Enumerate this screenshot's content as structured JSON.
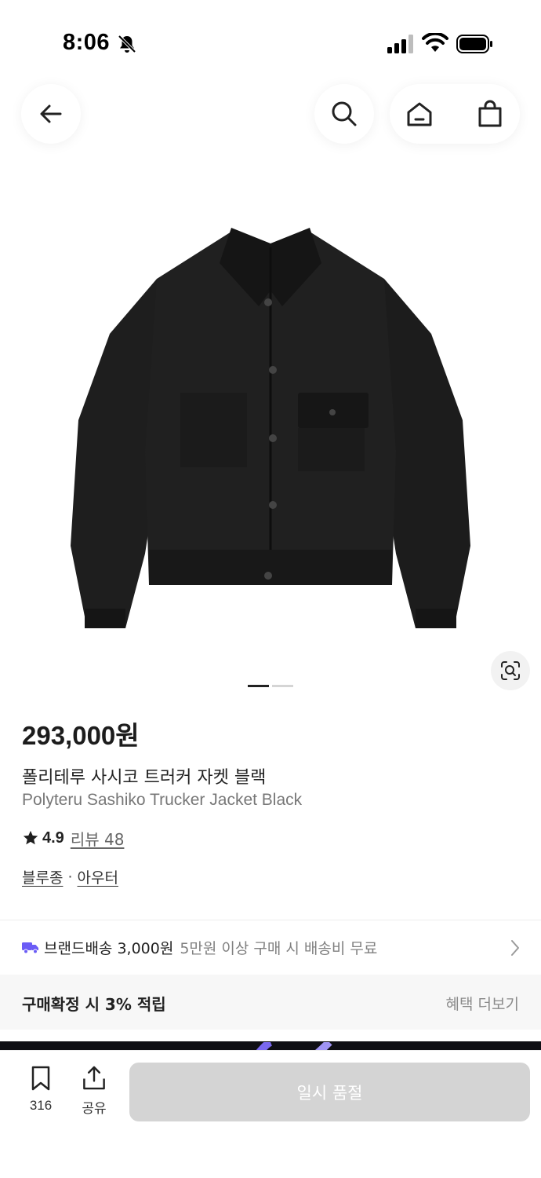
{
  "status_bar": {
    "time": "8:06",
    "icons": [
      "bell-slash-icon",
      "signal-icon",
      "wifi-icon",
      "battery-icon"
    ]
  },
  "header": {
    "icons": [
      "back-arrow-icon",
      "search-icon",
      "home-icon",
      "shopping-bag-icon"
    ]
  },
  "product": {
    "image_alt_icon": "black-jacket-image",
    "carousel": {
      "total": 2,
      "current": 1
    },
    "price": "293,000원",
    "name_ko": "폴리테루 사시코 트러커 자켓 블랙",
    "name_en": "Polyteru Sashiko Trucker Jacket Black",
    "rating": "4.9",
    "review_label": "리뷰 48",
    "categories": [
      "블루종",
      "아우터"
    ],
    "category_separator": "·"
  },
  "shipping": {
    "main": "브랜드배송 3,000원",
    "sub": "5만원 이상 구매 시 배송비 무료",
    "icon": "truck-icon"
  },
  "benefit": {
    "title": "구매확정 시 3% 적립",
    "more": "혜택 더보기"
  },
  "bottom_bar": {
    "bookmark_count": "316",
    "share_label": "공유",
    "sold_out_label": "일시 품절"
  },
  "colors": {
    "accent_purple": "#6b5cf6",
    "sold_out_bg": "#d4d4d4",
    "benefit_bg": "#f7f7f7"
  }
}
